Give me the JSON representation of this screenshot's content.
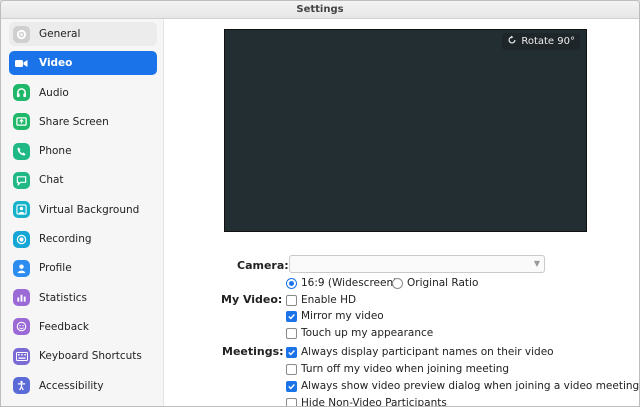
{
  "window": {
    "title": "Settings"
  },
  "sidebar": {
    "items": [
      {
        "label": "General",
        "icon": "gear-icon",
        "color": "#cfcfcf",
        "state": "hover"
      },
      {
        "label": "Video",
        "icon": "video-camera-icon",
        "color": "#1a73e8",
        "state": "active"
      },
      {
        "label": "Audio",
        "icon": "headphones-icon",
        "color": "#1fb86a"
      },
      {
        "label": "Share Screen",
        "icon": "share-screen-icon",
        "color": "#1fb86a"
      },
      {
        "label": "Phone",
        "icon": "phone-icon",
        "color": "#20b985"
      },
      {
        "label": "Chat",
        "icon": "chat-icon",
        "color": "#20b985"
      },
      {
        "label": "Virtual Background",
        "icon": "person-background-icon",
        "color": "#16b2c9"
      },
      {
        "label": "Recording",
        "icon": "record-icon",
        "color": "#16a6d6"
      },
      {
        "label": "Profile",
        "icon": "profile-icon",
        "color": "#2d8cf0"
      },
      {
        "label": "Statistics",
        "icon": "statistics-icon",
        "color": "#9b6ad6"
      },
      {
        "label": "Feedback",
        "icon": "feedback-smiley-icon",
        "color": "#9b6ad6"
      },
      {
        "label": "Keyboard Shortcuts",
        "icon": "keyboard-icon",
        "color": "#7a6ad6"
      },
      {
        "label": "Accessibility",
        "icon": "accessibility-icon",
        "color": "#5a6ad6"
      }
    ]
  },
  "video": {
    "rotate_label": "Rotate 90°",
    "camera_label": "Camera:",
    "camera_value": "",
    "my_video_label": "My Video:",
    "meetings_label": "Meetings:",
    "ratio_widescreen": "16:9 (Widescreen)",
    "ratio_original": "Original Ratio",
    "ratio_selected": "16:9 (Widescreen)",
    "options": {
      "enable_hd": {
        "label": "Enable HD",
        "checked": false
      },
      "mirror": {
        "label": "Mirror my video",
        "checked": true
      },
      "touch_up": {
        "label": "Touch up my appearance",
        "checked": false
      },
      "always_names": {
        "label": "Always display participant names on their video",
        "checked": true
      },
      "turn_off": {
        "label": "Turn off my video when joining meeting",
        "checked": false
      },
      "preview_dialog": {
        "label": "Always show video preview dialog when joining a video meeting",
        "checked": true
      },
      "hide_non_video": {
        "label": "Hide Non-Video Participants",
        "checked": false
      }
    }
  }
}
